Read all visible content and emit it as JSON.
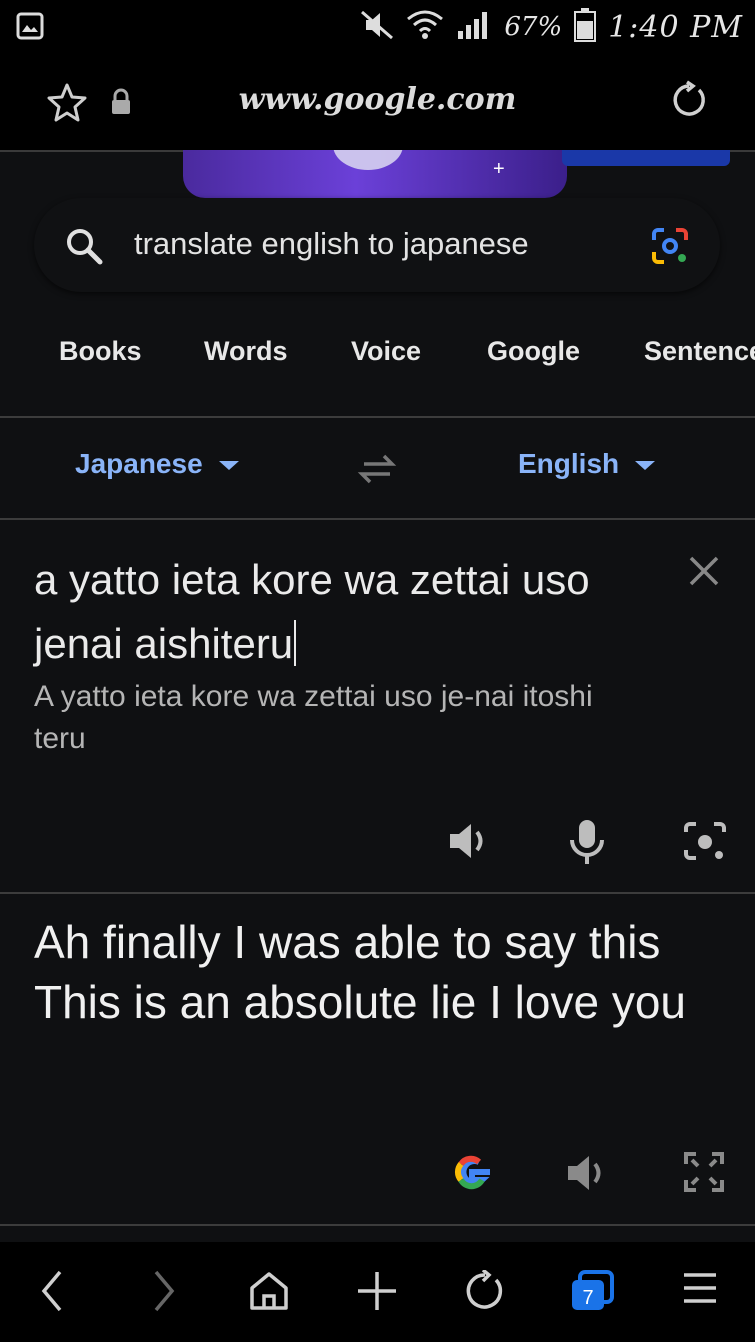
{
  "status_bar": {
    "battery_percent": "67%",
    "time": "1:40 PM",
    "icons": [
      "gallery-icon",
      "mute-icon",
      "wifi-icon",
      "signal-icon",
      "battery-icon"
    ]
  },
  "browser": {
    "url": "www.google.com",
    "icons": [
      "star-icon",
      "lock-icon",
      "reload-icon"
    ]
  },
  "search": {
    "query": "translate english to japanese",
    "icons": [
      "search-icon",
      "google-lens-icon"
    ]
  },
  "chips": [
    "Books",
    "Words",
    "Voice",
    "Google",
    "Sentence"
  ],
  "translator": {
    "source_lang": "Japanese",
    "target_lang": "English",
    "source_text": "a yatto ieta kore wa zettai uso jenai aishiteru",
    "transliteration": "A yatto ieta kore wa zettai uso je-nai itoshi teru",
    "result_text": "Ah finally I was able to say this This is an absolute lie I love you"
  },
  "bottom_nav": {
    "tab_count": "7",
    "icons": [
      "back-icon",
      "forward-icon",
      "home-icon",
      "new-tab-icon",
      "refresh-icon",
      "tabs-icon",
      "menu-icon"
    ]
  },
  "colors": {
    "accent": "#8ab4f8",
    "background": "#0f1012",
    "tab_badge": "#1a73e8"
  }
}
